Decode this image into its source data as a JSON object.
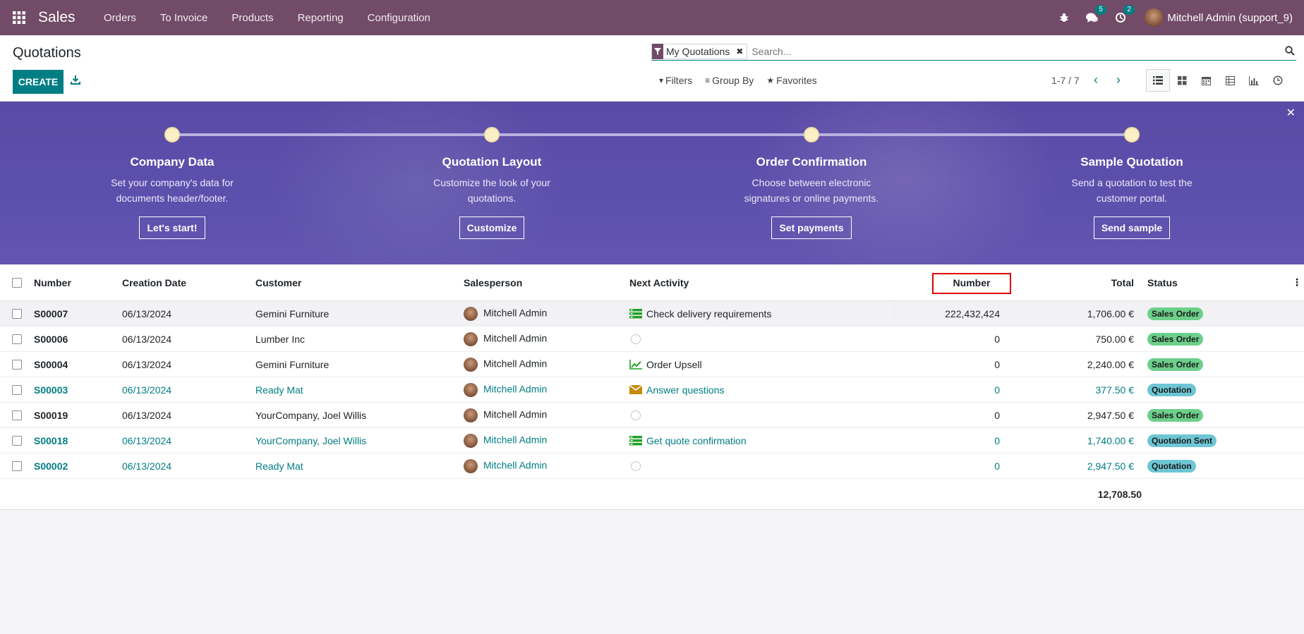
{
  "topbar": {
    "app_name": "Sales",
    "menu": [
      "Orders",
      "To Invoice",
      "Products",
      "Reporting",
      "Configuration"
    ],
    "messages_count": "5",
    "activities_count": "2",
    "user": "Mitchell Admin (support_9)"
  },
  "control": {
    "title": "Quotations",
    "create_label": "CREATE",
    "facet": "My Quotations",
    "search_placeholder": "Search...",
    "filters": "Filters",
    "group_by": "Group By",
    "favorites": "Favorites",
    "pager": "1-7 / 7"
  },
  "banner": {
    "steps": [
      {
        "title": "Company Data",
        "line1": "Set your company's data for",
        "line2": "documents header/footer.",
        "button": "Let's start!"
      },
      {
        "title": "Quotation Layout",
        "line1": "Customize the look of your",
        "line2": "quotations.",
        "button": "Customize"
      },
      {
        "title": "Order Confirmation",
        "line1": "Choose between electronic",
        "line2": "signatures or online payments.",
        "button": "Set payments"
      },
      {
        "title": "Sample Quotation",
        "line1": "Send a quotation to test the",
        "line2": "customer portal.",
        "button": "Send sample"
      }
    ]
  },
  "table": {
    "headers": {
      "number": "Number",
      "creation_date": "Creation Date",
      "customer": "Customer",
      "salesperson": "Salesperson",
      "next_activity": "Next Activity",
      "number2": "Number",
      "total": "Total",
      "status": "Status"
    },
    "rows": [
      {
        "number": "S00007",
        "date": "06/13/2024",
        "customer": "Gemini Furniture",
        "salesperson": "Mitchell Admin",
        "activity": "Check delivery requirements",
        "activity_icon": "task-icon",
        "num": "222,432,424",
        "total": "1,706.00 €",
        "status": "Sales Order"
      },
      {
        "number": "S00006",
        "date": "06/13/2024",
        "customer": "Lumber Inc",
        "salesperson": "Mitchell Admin",
        "activity": "",
        "activity_icon": "clock-icon",
        "num": "0",
        "total": "750.00 €",
        "status": "Sales Order"
      },
      {
        "number": "S00004",
        "date": "06/13/2024",
        "customer": "Gemini Furniture",
        "salesperson": "Mitchell Admin",
        "activity": "Order Upsell",
        "activity_icon": "upsell-icon",
        "num": "0",
        "total": "2,240.00 €",
        "status": "Sales Order"
      },
      {
        "number": "S00003",
        "date": "06/13/2024",
        "customer": "Ready Mat",
        "salesperson": "Mitchell Admin",
        "activity": "Answer questions",
        "activity_icon": "email-icon",
        "num": "0",
        "total": "377.50 €",
        "status": "Quotation"
      },
      {
        "number": "S00019",
        "date": "06/13/2024",
        "customer": "YourCompany, Joel Willis",
        "salesperson": "Mitchell Admin",
        "activity": "",
        "activity_icon": "clock-icon",
        "num": "0",
        "total": "2,947.50 €",
        "status": "Sales Order"
      },
      {
        "number": "S00018",
        "date": "06/13/2024",
        "customer": "YourCompany, Joel Willis",
        "salesperson": "Mitchell Admin",
        "activity": "Get quote confirmation",
        "activity_icon": "task-icon",
        "num": "0",
        "total": "1,740.00 €",
        "status": "Quotation Sent"
      },
      {
        "number": "S00002",
        "date": "06/13/2024",
        "customer": "Ready Mat",
        "salesperson": "Mitchell Admin",
        "activity": "",
        "activity_icon": "clock-icon",
        "num": "0",
        "total": "2,947.50 €",
        "status": "Quotation"
      }
    ],
    "footer_total": "12,708.50"
  },
  "colors": {
    "brand": "#714b67",
    "accent": "#017e84",
    "highlight": "#e00000",
    "banner": "#5a4aa6"
  }
}
